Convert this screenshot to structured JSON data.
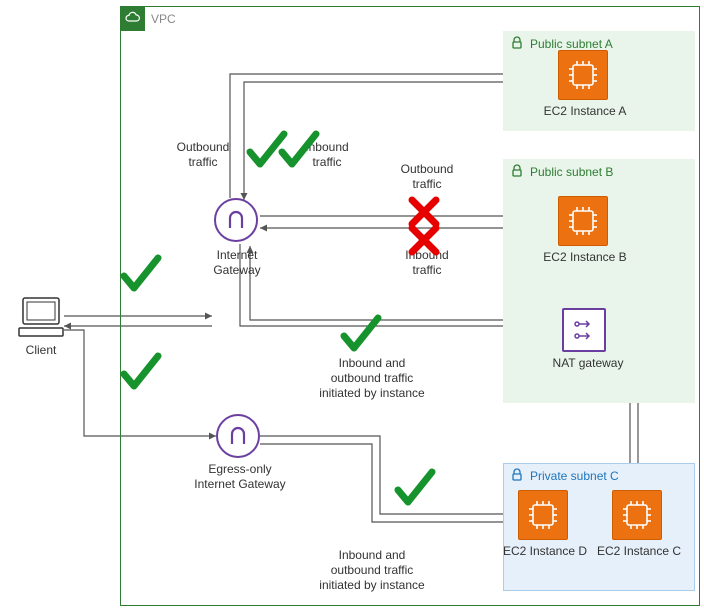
{
  "vpc": {
    "title": "VPC"
  },
  "subnets": {
    "pubA": {
      "title": "Public subnet A"
    },
    "pubB": {
      "title": "Public subnet B"
    },
    "priC": {
      "title": "Private subnet C"
    }
  },
  "nodes": {
    "client": {
      "label": "Client"
    },
    "igw": {
      "label": "Internet Gateway"
    },
    "egress": {
      "label": "Egress-only\nInternet Gateway"
    },
    "nat": {
      "label": "NAT gateway"
    },
    "ec2a": {
      "label": "EC2 Instance A"
    },
    "ec2b": {
      "label": "EC2 Instance B"
    },
    "ec2c": {
      "label": "EC2 Instance C"
    },
    "ec2d": {
      "label": "EC2 Instance D"
    }
  },
  "annotations": {
    "outbound_top": "Outbound\ntraffic",
    "inbound_top": "Inbound\ntraffic",
    "outbound_mid": "Outbound\ntraffic",
    "inbound_mid": "Inbound\ntraffic",
    "nat_traffic": "Inbound and\noutbound traffic\ninitiated by instance",
    "egress_traffic": "Inbound and\noutbound traffic\ninitiated by instance"
  },
  "status": {
    "client_igw_out": "allow",
    "client_igw_in": "allow",
    "igw_a_out": "allow",
    "igw_a_in": "allow",
    "igw_b_out": "deny",
    "igw_b_in": "deny",
    "nat_path": "allow",
    "egress_path": "allow"
  },
  "colors": {
    "aws_green": "#2e7d32",
    "aws_blue": "#1e75bc",
    "aws_orange": "#ec7211",
    "aws_purple": "#6b3fa0",
    "allow": "#16932c",
    "deny": "#e60000"
  }
}
